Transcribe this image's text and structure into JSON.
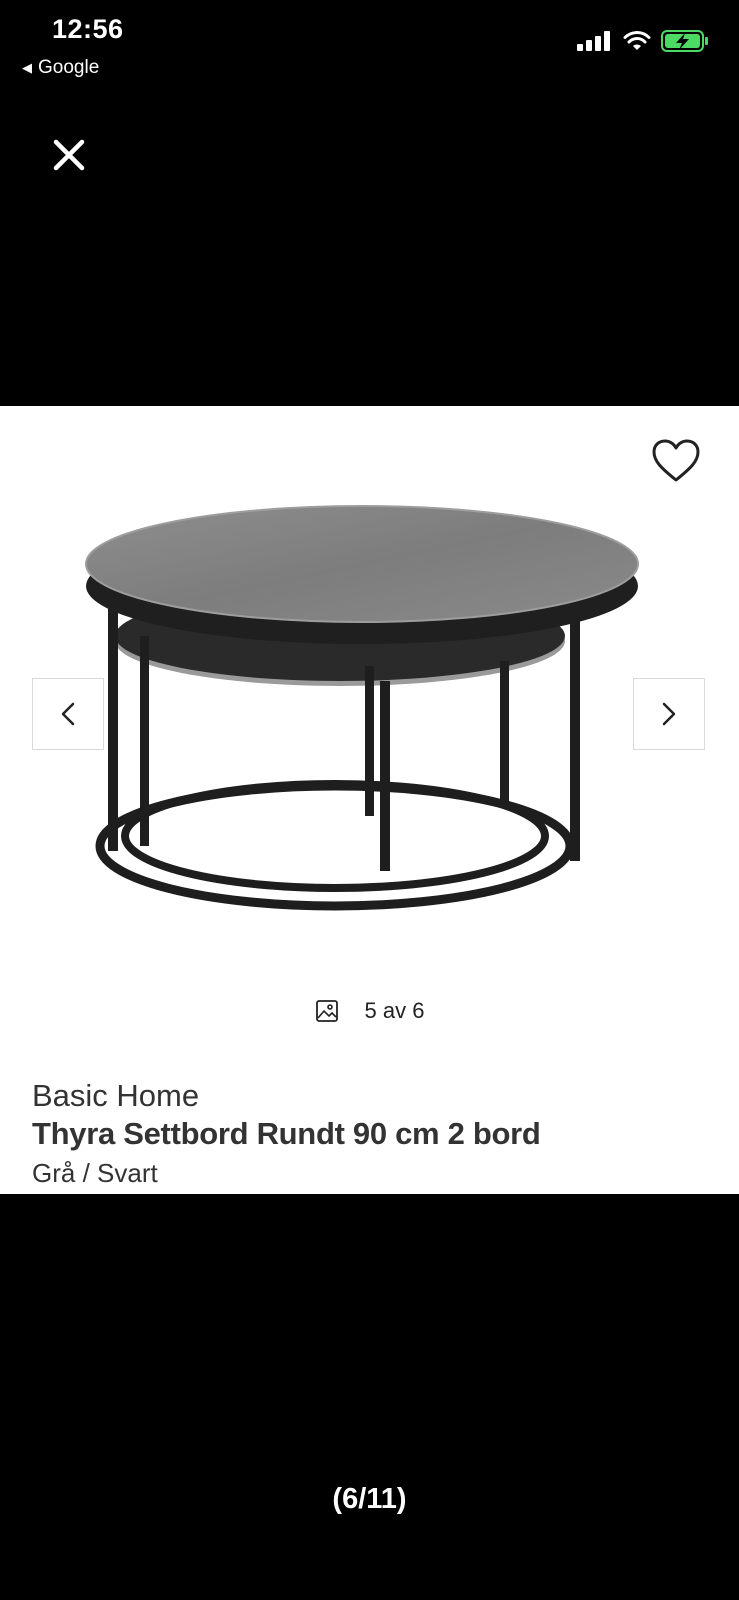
{
  "status_bar": {
    "time": "12:56",
    "back_app": "Google",
    "icons": [
      "signal-icon",
      "wifi-icon",
      "battery-charging-icon"
    ]
  },
  "viewer": {
    "close_icon": "close-icon",
    "pager": "(6/11)"
  },
  "product": {
    "favorite_icon": "heart-outline-icon",
    "prev_icon": "chevron-left-icon",
    "next_icon": "chevron-right-icon",
    "image_counter": "5 av 6",
    "image_counter_icon": "image-icon",
    "brand": "Basic Home",
    "title": "Thyra Settbord Rundt 90 cm 2 bord",
    "variant": "Grå / Svart"
  },
  "colors": {
    "background": "#000000",
    "card": "#ffffff",
    "text": "#333333",
    "battery": "#4cd964"
  }
}
